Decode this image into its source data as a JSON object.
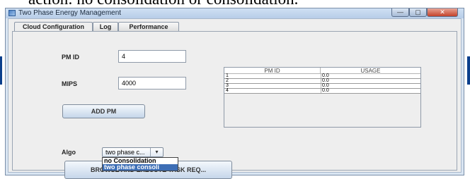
{
  "document": {
    "fragment_text": "action: no consolidation or consolidation."
  },
  "window": {
    "title": "Two Phase Energy Management",
    "controls": {
      "minimize": "—",
      "maximize": "▢",
      "close": "✕"
    }
  },
  "tabs": [
    {
      "label": "Cloud Configuration",
      "active": true
    },
    {
      "label": "Log",
      "active": false
    },
    {
      "label": "Performance",
      "active": false
    }
  ],
  "form": {
    "pm_id_label": "PM ID",
    "pm_id_value": "4",
    "mips_label": "MIPS",
    "mips_value": "4000",
    "add_pm_button": "ADD PM",
    "algo_label": "Algo",
    "algo_selected": "two phase c...",
    "algo_arrow": "▾",
    "algo_options": [
      {
        "label": "no Consolidation",
        "highlighted": false
      },
      {
        "label": "two phase consoli",
        "highlighted": true
      }
    ],
    "browse_button": "BROWSE AND EXECUTE TASK REQ..."
  },
  "pm_table": {
    "columns": [
      "PM ID",
      "USAGE"
    ],
    "rows": [
      [
        "1",
        "0.0"
      ],
      [
        "2",
        "0.0"
      ],
      [
        "3",
        "0.0"
      ],
      [
        "4",
        "0.0"
      ]
    ]
  },
  "colors": {
    "window_frame": "#d9e5f2",
    "panel_bg": "#eeeeee",
    "selection": "#3d6eb5",
    "close_button": "#c3432b"
  }
}
